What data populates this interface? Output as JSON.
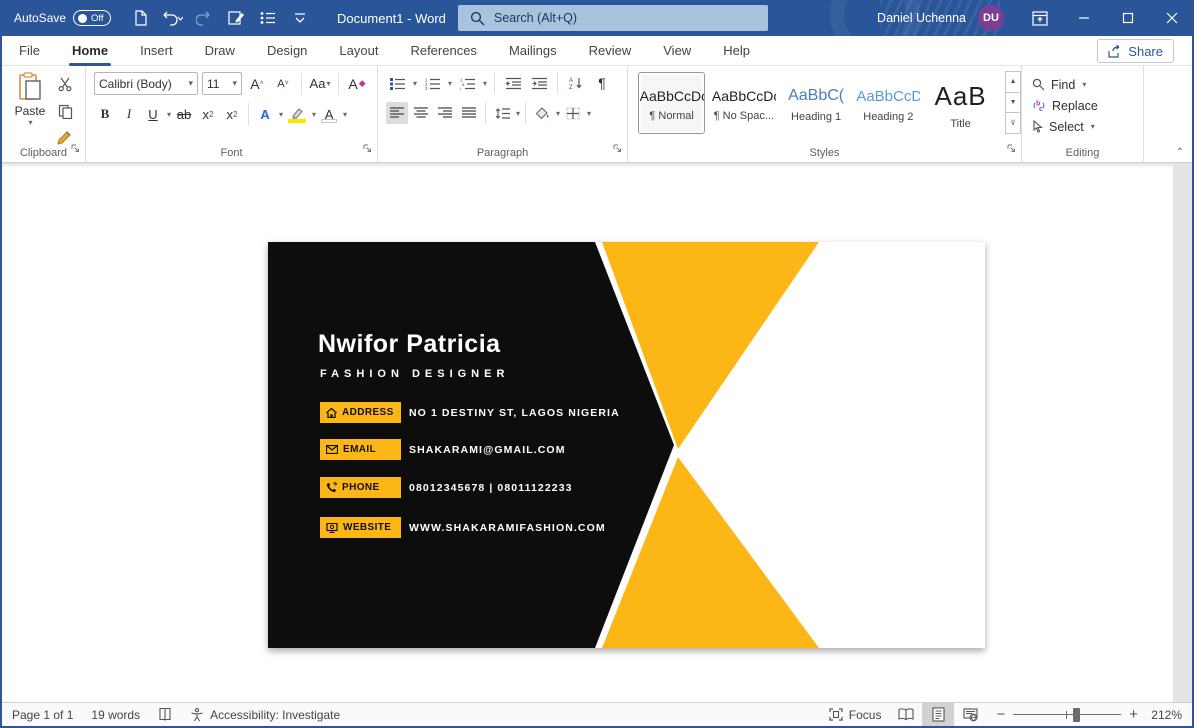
{
  "titlebar": {
    "autosave_label": "AutoSave",
    "autosave_state": "Off",
    "title": "Document1 - Word",
    "search_placeholder": "Search (Alt+Q)",
    "user_name": "Daniel Uchenna",
    "user_initials": "DU",
    "colors": {
      "bar": "#2a5699",
      "avatar": "#7b3e93"
    }
  },
  "tabs": [
    {
      "label": "File"
    },
    {
      "label": "Home",
      "active": true
    },
    {
      "label": "Insert"
    },
    {
      "label": "Draw"
    },
    {
      "label": "Design"
    },
    {
      "label": "Layout"
    },
    {
      "label": "References"
    },
    {
      "label": "Mailings"
    },
    {
      "label": "Review"
    },
    {
      "label": "View"
    },
    {
      "label": "Help"
    }
  ],
  "share_label": "Share",
  "ribbon": {
    "clipboard": {
      "label": "Clipboard",
      "paste_label": "Paste"
    },
    "font": {
      "label": "Font",
      "font_name": "Calibri (Body)",
      "font_size": "11",
      "bold": "B",
      "italic": "I",
      "underline": "U",
      "strike": "ab",
      "subscript": "x",
      "superscript": "x",
      "case_label": "Aa",
      "effects": "A",
      "fontcolor_letter": "A",
      "highlight_color": "#ffe400",
      "font_color_swatch": "#ffffff"
    },
    "paragraph": {
      "label": "Paragraph",
      "pilcrow": "¶",
      "sort": "A↓Z"
    },
    "styles": {
      "label": "Styles",
      "items": [
        {
          "sample": "AaBbCcDc",
          "name": "¶ Normal",
          "selected": true
        },
        {
          "sample": "AaBbCcDc",
          "name": "¶ No Spac..."
        },
        {
          "sample": "AaBbC(",
          "name": "Heading 1"
        },
        {
          "sample": "AaBbCcD",
          "name": "Heading 2"
        },
        {
          "sample": "AaB",
          "name": "Title"
        }
      ]
    },
    "editing": {
      "label": "Editing",
      "find": "Find",
      "replace": "Replace",
      "select": "Select"
    }
  },
  "card": {
    "name": "Nwifor Patricia",
    "role": "FASHION DESIGNER",
    "contacts": [
      {
        "label": "ADDRESS",
        "value": "NO 1 DESTINY ST, LAGOS NIGERIA"
      },
      {
        "label": "EMAIL",
        "value": "SHAKARAMI@GMAIL.COM"
      },
      {
        "label": "PHONE",
        "value": "08012345678  |  08011122233"
      },
      {
        "label": "WEBSITE",
        "value": "WWW.SHAKARAMIFASHION.COM"
      }
    ],
    "colors": {
      "yellow": "#fcb615",
      "black": "#0d0d0d"
    }
  },
  "statusbar": {
    "page": "Page 1 of 1",
    "words": "19 words",
    "accessibility": "Accessibility: Investigate",
    "focus": "Focus",
    "zoom": "212%"
  }
}
